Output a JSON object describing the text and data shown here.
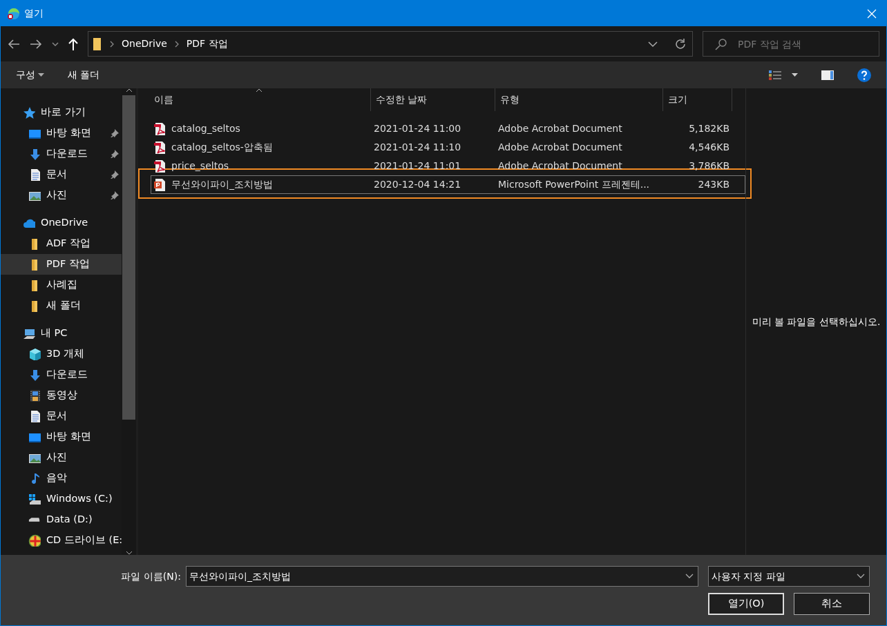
{
  "window": {
    "title": "열기"
  },
  "address": {
    "path": [
      "OneDrive",
      "PDF 작업"
    ],
    "search_placeholder": "PDF 작업 검색"
  },
  "toolbar": {
    "organize": "구성",
    "new_folder": "새 폴더"
  },
  "sidebar": {
    "items": [
      {
        "label": "바로 가기",
        "kind": "star",
        "selected": false,
        "children": [
          {
            "label": "바탕 화면",
            "kind": "desktop",
            "pinned": true,
            "selected": false
          },
          {
            "label": "다운로드",
            "kind": "download",
            "pinned": true,
            "selected": false
          },
          {
            "label": "문서",
            "kind": "document",
            "pinned": true,
            "selected": false
          },
          {
            "label": "사진",
            "kind": "pictures",
            "pinned": true,
            "selected": false
          }
        ]
      },
      {
        "label": "OneDrive",
        "kind": "cloud",
        "selected": false,
        "children": [
          {
            "label": "ADF 작업",
            "kind": "folder",
            "pinned": false,
            "selected": false
          },
          {
            "label": "PDF 작업",
            "kind": "folder",
            "pinned": false,
            "selected": true
          },
          {
            "label": "사례집",
            "kind": "folder",
            "pinned": false,
            "selected": false
          },
          {
            "label": "새 폴더",
            "kind": "folder",
            "pinned": false,
            "selected": false
          }
        ]
      },
      {
        "label": "내 PC",
        "kind": "pc",
        "selected": false,
        "children": [
          {
            "label": "3D 개체",
            "kind": "cube",
            "pinned": false,
            "selected": false
          },
          {
            "label": "다운로드",
            "kind": "download",
            "pinned": false,
            "selected": false
          },
          {
            "label": "동영상",
            "kind": "video",
            "pinned": false,
            "selected": false
          },
          {
            "label": "문서",
            "kind": "document",
            "pinned": false,
            "selected": false
          },
          {
            "label": "바탕 화면",
            "kind": "desktop",
            "pinned": false,
            "selected": false
          },
          {
            "label": "사진",
            "kind": "pictures",
            "pinned": false,
            "selected": false
          },
          {
            "label": "음악",
            "kind": "music",
            "pinned": false,
            "selected": false
          },
          {
            "label": "Windows (C:)",
            "kind": "windows-drive",
            "pinned": false,
            "selected": false
          },
          {
            "label": "Data (D:)",
            "kind": "drive",
            "pinned": false,
            "selected": false
          },
          {
            "label": "CD 드라이브 (E:",
            "kind": "cd",
            "pinned": false,
            "selected": false
          }
        ]
      }
    ]
  },
  "table": {
    "columns": [
      "이름",
      "수정한 날짜",
      "유형",
      "크기"
    ],
    "rows": [
      {
        "kind": "pdf",
        "name": "catalog_seltos",
        "date": "2021-01-24 11:00",
        "type": "Adobe Acrobat Document",
        "size": "5,182KB",
        "selected": false,
        "highlighted": false
      },
      {
        "kind": "pdf",
        "name": "catalog_seltos-압축됨",
        "date": "2021-01-24 11:10",
        "type": "Adobe Acrobat Document",
        "size": "4,546KB",
        "selected": false,
        "highlighted": false
      },
      {
        "kind": "pdf",
        "name": "price_seltos",
        "date": "2021-01-24 11:01",
        "type": "Adobe Acrobat Document",
        "size": "3,786KB",
        "selected": false,
        "highlighted": false
      },
      {
        "kind": "ppt",
        "name": "무선와이파이_조치방법",
        "date": "2020-12-04 14:21",
        "type": "Microsoft PowerPoint 프레젠테...",
        "size": "243KB",
        "selected": true,
        "highlighted": true
      }
    ]
  },
  "preview": {
    "message": "미리 볼 파일을 선택하십시오."
  },
  "footer": {
    "filename_label": "파일 이름(N):",
    "filename": "무선와이파이_조치방법",
    "filter": "사용자 지정 파일",
    "open": "열기(O)",
    "cancel": "취소"
  }
}
